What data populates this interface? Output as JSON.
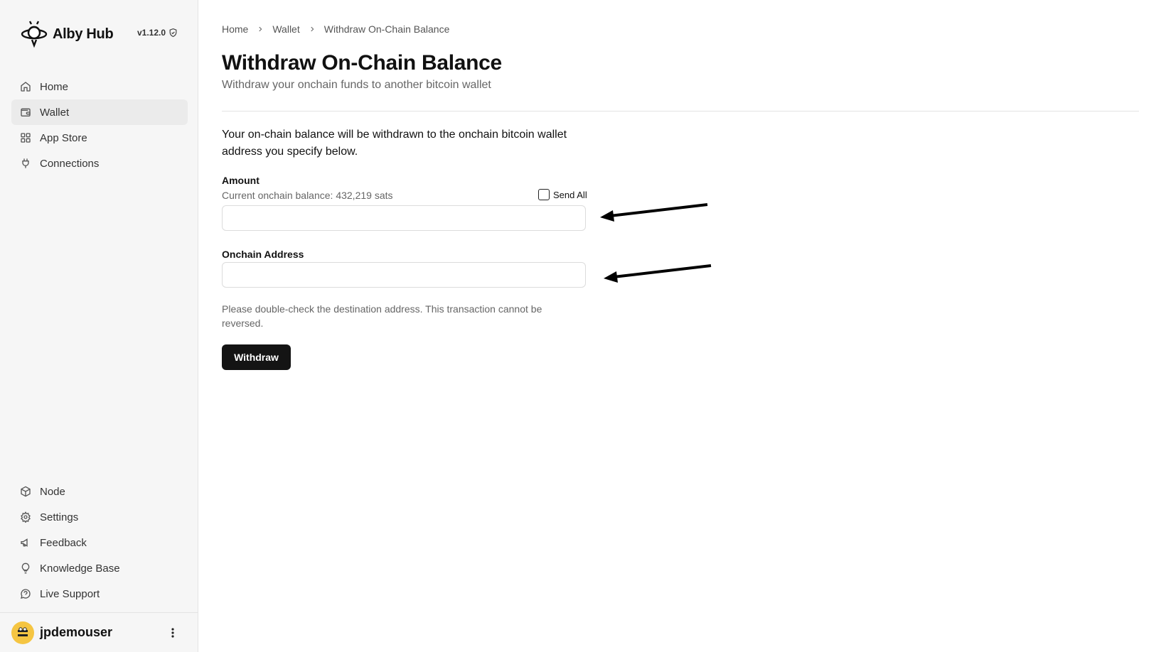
{
  "app": {
    "brand_name": "Alby Hub",
    "version": "v1.12.0"
  },
  "sidebar": {
    "top_items": [
      {
        "label": "Home",
        "icon": "home-icon",
        "active": false
      },
      {
        "label": "Wallet",
        "icon": "wallet-icon",
        "active": true
      },
      {
        "label": "App Store",
        "icon": "grid-icon",
        "active": false
      },
      {
        "label": "Connections",
        "icon": "plug-icon",
        "active": false
      }
    ],
    "bottom_items": [
      {
        "label": "Node",
        "icon": "cube-icon"
      },
      {
        "label": "Settings",
        "icon": "gear-icon"
      },
      {
        "label": "Feedback",
        "icon": "megaphone-icon"
      },
      {
        "label": "Knowledge Base",
        "icon": "lightbulb-icon"
      },
      {
        "label": "Live Support",
        "icon": "chat-icon"
      }
    ],
    "user": {
      "name": "jpdemouser"
    }
  },
  "breadcrumb": [
    "Home",
    "Wallet",
    "Withdraw On-Chain Balance"
  ],
  "page": {
    "title": "Withdraw On-Chain Balance",
    "subtitle": "Withdraw your onchain funds to another bitcoin wallet",
    "intro": "Your on-chain balance will be withdrawn to the onchain bitcoin wallet address you specify below."
  },
  "form": {
    "amount_label": "Amount",
    "balance_text": "Current onchain balance: 432,219 sats",
    "send_all_label": "Send All",
    "send_all_checked": false,
    "amount_value": "",
    "address_label": "Onchain Address",
    "address_value": "",
    "warning": "Please double-check the destination address. This transaction cannot be reversed.",
    "submit_label": "Withdraw"
  },
  "colors": {
    "sidebar_bg": "#f6f6f6",
    "active_item_bg": "#ebebeb",
    "button_bg": "#141414",
    "muted_text": "#666666"
  }
}
